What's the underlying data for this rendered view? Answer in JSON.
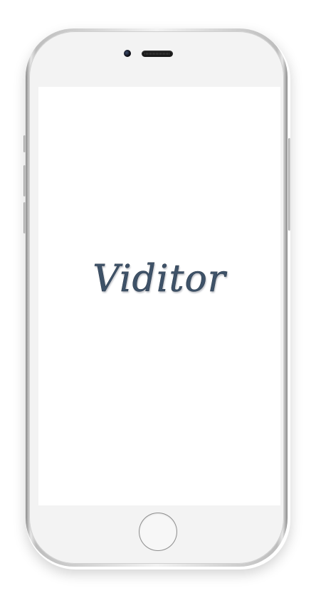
{
  "app": {
    "logo_text": "Viditor"
  },
  "device": {
    "icons": [
      "front-camera-icon",
      "earpiece-speaker-icon",
      "home-button-icon"
    ]
  },
  "colors": {
    "logo": "#3e5268",
    "screen_background": "#ffffff",
    "bezel": "#f3f3f3"
  }
}
